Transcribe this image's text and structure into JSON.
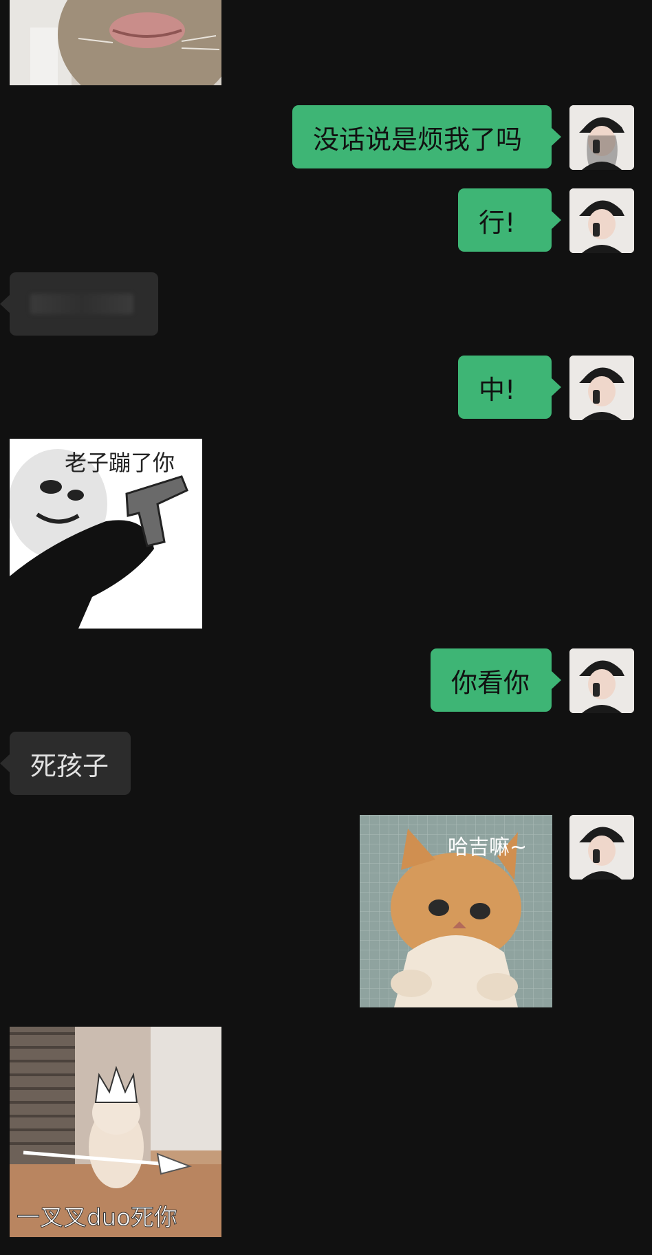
{
  "messages": [
    {
      "id": "m0",
      "sender": "them",
      "type": "sticker",
      "caption": "",
      "icon": "cat-lips-sticker"
    },
    {
      "id": "m1",
      "sender": "me",
      "type": "text",
      "text": "没话说是烦我了吗"
    },
    {
      "id": "m2",
      "sender": "me",
      "type": "text",
      "text": "行!"
    },
    {
      "id": "m3",
      "sender": "them",
      "type": "text",
      "text": "",
      "note_visible": "redacted/blurred"
    },
    {
      "id": "m4",
      "sender": "me",
      "type": "text",
      "text": "中!"
    },
    {
      "id": "m5",
      "sender": "them",
      "type": "sticker",
      "caption": "老子蹦了你",
      "icon": "panda-gun-sticker"
    },
    {
      "id": "m6",
      "sender": "me",
      "type": "text",
      "text": "你看你"
    },
    {
      "id": "m7",
      "sender": "them",
      "type": "text",
      "text": "死孩子"
    },
    {
      "id": "m8",
      "sender": "me",
      "type": "sticker",
      "caption": "哈吉嘛~",
      "icon": "orange-kitten-sticker"
    },
    {
      "id": "m9",
      "sender": "them",
      "type": "sticker",
      "caption": "一叉叉duo死你",
      "icon": "spear-kitten-sticker"
    }
  ],
  "colors": {
    "background": "#111111",
    "my_bubble": "#3eb575",
    "their_bubble": "#2c2c2c",
    "their_text": "#e2e2e2",
    "my_text": "#111111"
  },
  "avatar_icon": "user-avatar-woman-hat"
}
